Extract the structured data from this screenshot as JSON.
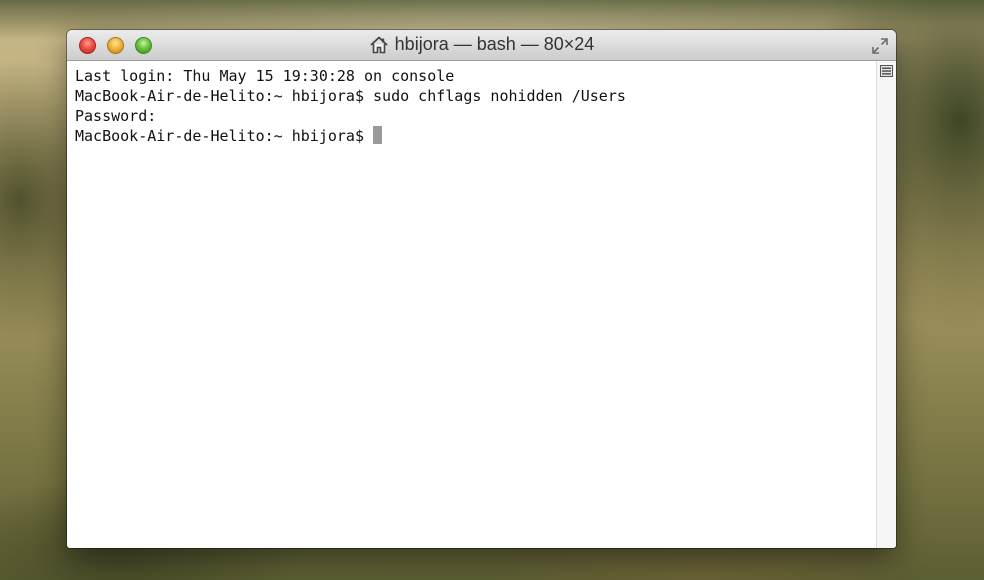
{
  "window": {
    "title": "hbijora — bash — 80×24",
    "title_icon": "home-icon",
    "buttons": {
      "close": "close-button",
      "minimize": "minimize-button",
      "zoom": "zoom-button"
    },
    "fullscreen_icon": "fullscreen-icon"
  },
  "terminal": {
    "lines": [
      "Last login: Thu May 15 19:30:28 on console",
      "MacBook-Air-de-Helito:~ hbijora$ sudo chflags nohidden /Users",
      "Password:",
      "MacBook-Air-de-Helito:~ hbijora$ "
    ],
    "cursor_color": "#9a9a9a"
  },
  "colors": {
    "close": "#ee4f46",
    "minimize": "#f2b53a",
    "zoom": "#6cc23f"
  }
}
